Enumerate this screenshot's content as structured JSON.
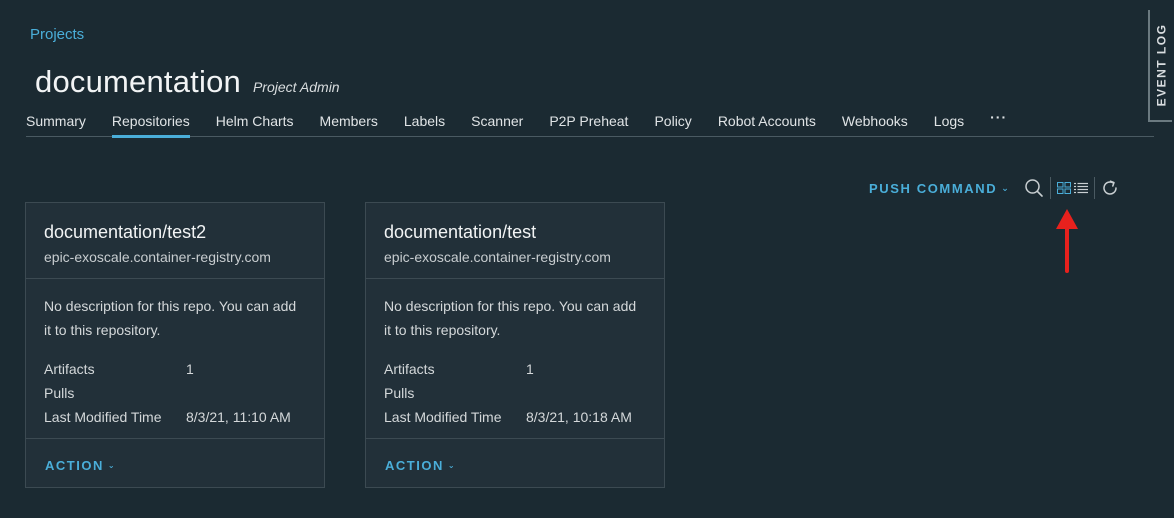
{
  "breadcrumb": {
    "label": "Projects"
  },
  "header": {
    "title": "documentation",
    "role": "Project Admin"
  },
  "tabs": [
    {
      "label": "Summary"
    },
    {
      "label": "Repositories",
      "active": true
    },
    {
      "label": "Helm Charts"
    },
    {
      "label": "Members"
    },
    {
      "label": "Labels"
    },
    {
      "label": "Scanner"
    },
    {
      "label": "P2P Preheat"
    },
    {
      "label": "Policy"
    },
    {
      "label": "Robot Accounts"
    },
    {
      "label": "Webhooks"
    },
    {
      "label": "Logs"
    },
    {
      "label": "···"
    }
  ],
  "event_log": {
    "label": "EVENT LOG"
  },
  "toolbar": {
    "push_command_label": "PUSH COMMAND",
    "icons": [
      "search-icon",
      "card-view-icon",
      "list-view-icon",
      "refresh-icon"
    ]
  },
  "colors": {
    "accent": "#4aaed9",
    "background": "#1b2a32",
    "card": "#223039",
    "arrow": "#e8211d"
  },
  "repositories": [
    {
      "name": "documentation/test2",
      "host": "epic-exoscale.container-registry.com",
      "description": "No description for this repo. You can add it to this repository.",
      "artifacts_label": "Artifacts",
      "artifacts_value": "1",
      "pulls_label": "Pulls",
      "pulls_value": "",
      "modified_label": "Last Modified Time",
      "modified_value": "8/3/21, 11:10 AM",
      "action_label": "ACTION"
    },
    {
      "name": "documentation/test",
      "host": "epic-exoscale.container-registry.com",
      "description": "No description for this repo. You can add it to this repository.",
      "artifacts_label": "Artifacts",
      "artifacts_value": "1",
      "pulls_label": "Pulls",
      "pulls_value": "",
      "modified_label": "Last Modified Time",
      "modified_value": "8/3/21, 10:18 AM",
      "action_label": "ACTION"
    }
  ]
}
